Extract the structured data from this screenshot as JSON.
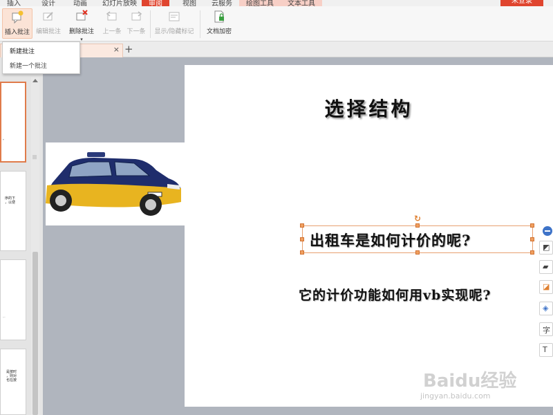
{
  "menu": {
    "tabs": [
      "插入",
      "设计",
      "动画",
      "幻灯片放映",
      "审阅",
      "视图",
      "云服务",
      "绘图工具",
      "文本工具"
    ],
    "active_tab": "审阅",
    "login": "未登录"
  },
  "ribbon": {
    "buttons": [
      {
        "label": "插入批注",
        "icon": "insert-comment-icon",
        "state": "active"
      },
      {
        "label": "编辑批注",
        "icon": "edit-comment-icon",
        "state": "disabled"
      },
      {
        "label": "删除批注",
        "icon": "delete-comment-icon",
        "state": "enabled"
      },
      {
        "label": "上一条",
        "icon": "previous-icon",
        "state": "disabled"
      },
      {
        "label": "下一条",
        "icon": "next-icon",
        "state": "disabled"
      },
      {
        "label": "显示/隐藏标记",
        "icon": "show-hide-markup-icon",
        "state": "disabled"
      },
      {
        "label": "文档加密",
        "icon": "encrypt-document-icon",
        "state": "enabled"
      }
    ]
  },
  "tooltip": {
    "title": "新建批注",
    "description": "新建一个批注"
  },
  "thumbnails": [
    {
      "text": ""
    },
    {
      "text": "序的下\n，以便"
    },
    {
      "text": ""
    },
    {
      "text": "是按时\n，则对\n也在按"
    }
  ],
  "slide": {
    "title": "选择结构",
    "textbox": "出租车是如何计价的呢?",
    "subtitle": "它的计价功能如何用vb实现呢?",
    "image": "taxi-car"
  },
  "right_toolbar": [
    "minus-icon",
    "edit-shape-icon",
    "fill-color-icon",
    "outline-icon",
    "layers-icon",
    "text-style-icon",
    "text-box-icon"
  ],
  "watermark": {
    "logo": "Baidu经验",
    "url": "jingyan.baidu.com"
  },
  "colors": {
    "accent": "#e0452f",
    "selection": "#e8a070"
  }
}
